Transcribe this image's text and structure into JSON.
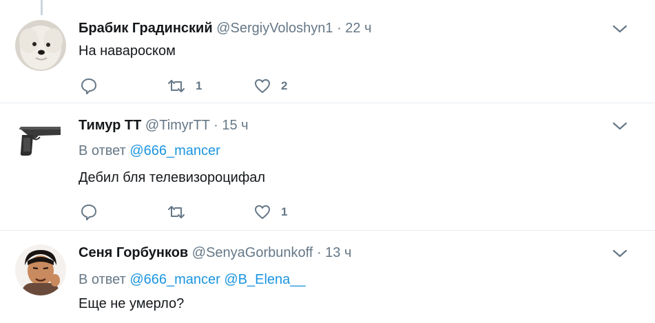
{
  "tweets": [
    {
      "name": "Брабик Градинский",
      "handle": "@SergiyVoloshyn1",
      "separator": "·",
      "time": "22 ч",
      "text": "На навароском",
      "retweets": "1",
      "likes": "2"
    },
    {
      "name": "Тимур ТТ",
      "handle": "@TimyrTT",
      "separator": "·",
      "time": "15 ч",
      "reply_prefix": "В ответ",
      "reply_mentions": [
        "@666_mancer"
      ],
      "text": "Дебил бля телевизороцифал",
      "retweets": "",
      "likes": "1"
    },
    {
      "name": "Сеня Горбунков",
      "handle": "@SenyaGorbunkoff",
      "separator": "·",
      "time": "13 ч",
      "reply_prefix": "В ответ",
      "reply_mentions": [
        "@666_mancer",
        "@B_Elena__"
      ],
      "text": "Еще не умерло?"
    }
  ],
  "colors": {
    "text": "#14171a",
    "secondary": "#657786",
    "link": "#1b95e0",
    "divider": "#e6ecf0"
  }
}
